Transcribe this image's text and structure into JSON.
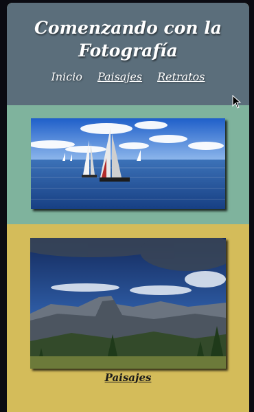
{
  "header": {
    "title": "Comenzando con la Fotografía",
    "nav": [
      {
        "label": "Inicio"
      },
      {
        "label": "Paisajes"
      },
      {
        "label": "Retratos"
      }
    ]
  },
  "gallery": {
    "caption": "Paisajes"
  },
  "colors": {
    "header_bg": "#5b6e7b",
    "section_teal": "#7fb39d",
    "section_gold": "#d4bc5a",
    "frame_bg": "#0b0b12"
  }
}
